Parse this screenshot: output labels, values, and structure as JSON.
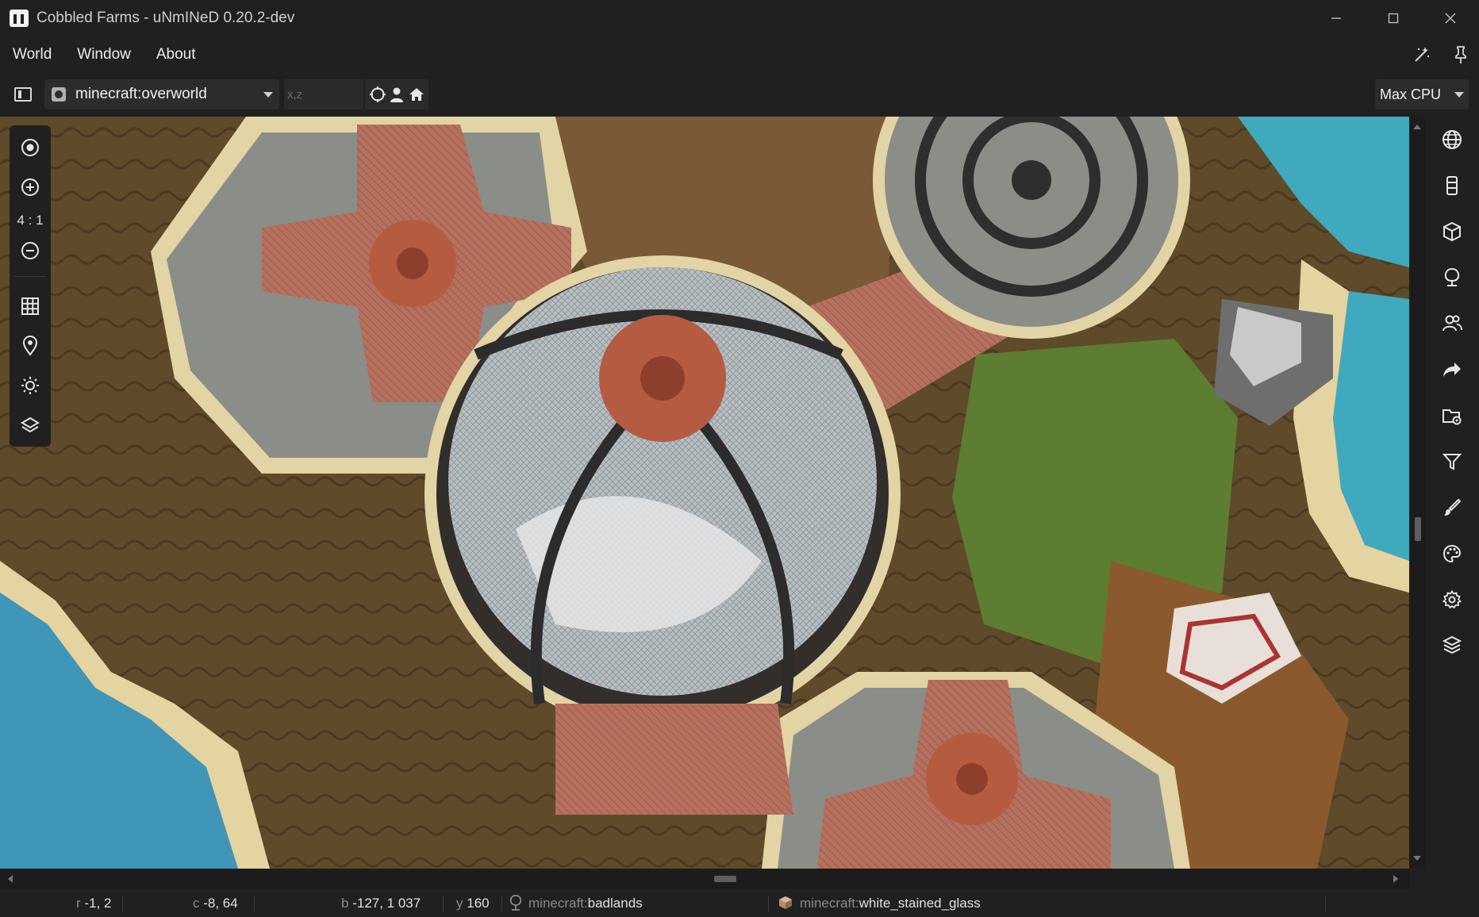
{
  "window": {
    "title": "Cobbled Farms - uNmINeD 0.20.2-dev",
    "controls": [
      "minimize",
      "maximize",
      "close"
    ]
  },
  "menu": {
    "items": [
      "World",
      "Window",
      "About"
    ],
    "right_icons": [
      "wand-icon",
      "pin-icon"
    ]
  },
  "toolbar": {
    "dimension": "minecraft:overworld",
    "coords_placeholder": "x,z",
    "coord_buttons": [
      "crosshair-icon",
      "player-icon",
      "home-icon"
    ],
    "cpu_mode": "Max CPU"
  },
  "map_tools": {
    "zoom_ratio": "4 : 1",
    "items": [
      "center-icon",
      "zoom-in-icon",
      "zoom-out-icon",
      "grid-icon",
      "marker-icon",
      "light-icon",
      "layers-icon"
    ]
  },
  "right_sidebar": {
    "icons": [
      "globe-icon",
      "column-icon",
      "cube-icon",
      "tree-icon",
      "players-icon",
      "share-icon",
      "folder-settings-icon",
      "filter-icon",
      "brush-icon",
      "palette-icon",
      "settings-icon",
      "layers-icon"
    ]
  },
  "status": {
    "region_key": "r",
    "region_val": "-1, 2",
    "chunk_key": "c",
    "chunk_val": "-8, 64",
    "block_key": "b",
    "block_val": "-127, 1 037",
    "y_key": "y",
    "y_val": "160",
    "biome_ns": "minecraft:",
    "biome_name": "badlands",
    "block_ns": "minecraft:",
    "block_name": "white_stained_glass"
  }
}
